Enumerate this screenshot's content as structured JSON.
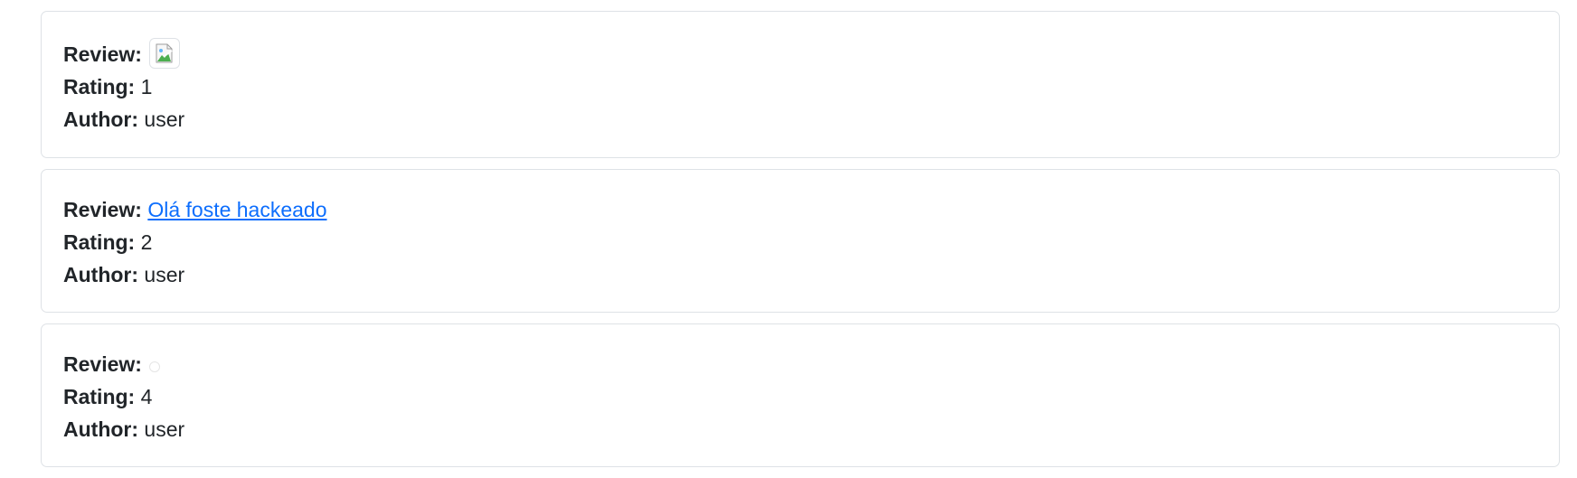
{
  "labels": {
    "review": "Review:",
    "rating": "Rating:",
    "author": "Author:"
  },
  "reviews": [
    {
      "review_content": "broken-image-icon",
      "rating": "1",
      "author": "user"
    },
    {
      "review_link_text": "Olá foste hackeado",
      "rating": "2",
      "author": "user"
    },
    {
      "review_content": "circle-icon",
      "rating": "4",
      "author": "user"
    }
  ],
  "colors": {
    "link": "#0d6efd",
    "text": "#212529",
    "border": "#dee2e6"
  }
}
